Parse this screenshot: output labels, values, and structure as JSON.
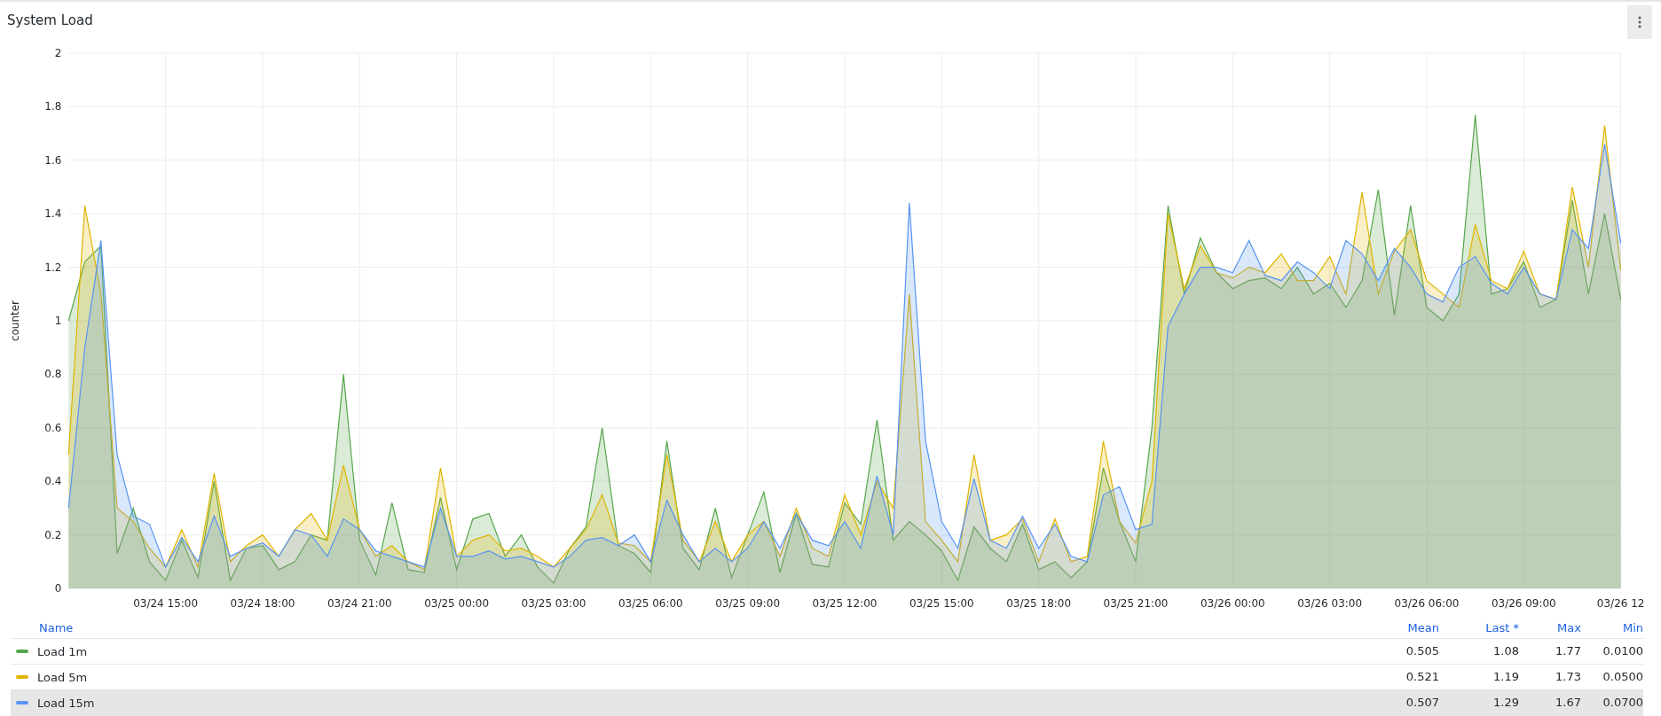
{
  "panel": {
    "title": "System Load",
    "chart_data": {
      "type": "area",
      "ylabel": "counter",
      "categories": [
        null,
        null,
        null,
        null,
        null,
        null,
        "03/24 15:00",
        null,
        null,
        null,
        null,
        null,
        "03/24 18:00",
        null,
        null,
        null,
        null,
        null,
        "03/24 21:00",
        null,
        null,
        null,
        null,
        null,
        "03/25 00:00",
        null,
        null,
        null,
        null,
        null,
        "03/25 03:00",
        null,
        null,
        null,
        null,
        null,
        "03/25 06:00",
        null,
        null,
        null,
        null,
        null,
        "03/25 09:00",
        null,
        null,
        null,
        null,
        null,
        "03/25 12:00",
        null,
        null,
        null,
        null,
        null,
        "03/25 15:00",
        null,
        null,
        null,
        null,
        null,
        "03/25 18:00",
        null,
        null,
        null,
        null,
        null,
        "03/25 21:00",
        null,
        null,
        null,
        null,
        null,
        "03/26 00:00",
        null,
        null,
        null,
        null,
        null,
        "03/26 03:00",
        null,
        null,
        null,
        null,
        null,
        "03/26 06:00",
        null,
        null,
        null,
        null,
        null,
        "03/26 09:00",
        null,
        null,
        null,
        null,
        null,
        "03/26 12"
      ],
      "series": [
        {
          "name": "Load 1m",
          "color": "#56a64b",
          "values": [
            1.0,
            1.22,
            1.28,
            0.13,
            0.3,
            0.1,
            0.03,
            0.18,
            0.04,
            0.4,
            0.03,
            0.15,
            0.16,
            0.07,
            0.1,
            0.2,
            0.18,
            0.8,
            0.18,
            0.05,
            0.32,
            0.07,
            0.06,
            0.34,
            0.07,
            0.26,
            0.28,
            0.12,
            0.2,
            0.08,
            0.02,
            0.15,
            0.23,
            0.6,
            0.16,
            0.13,
            0.06,
            0.55,
            0.15,
            0.07,
            0.3,
            0.04,
            0.2,
            0.36,
            0.06,
            0.28,
            0.09,
            0.08,
            0.32,
            0.24,
            0.63,
            0.18,
            0.25,
            0.2,
            0.14,
            0.03,
            0.23,
            0.15,
            0.1,
            0.24,
            0.07,
            0.1,
            0.04,
            0.1,
            0.45,
            0.25,
            0.1,
            0.6,
            1.43,
            1.1,
            1.31,
            1.18,
            1.12,
            1.15,
            1.16,
            1.12,
            1.2,
            1.1,
            1.14,
            1.05,
            1.15,
            1.49,
            1.02,
            1.43,
            1.05,
            1.0,
            1.1,
            1.77,
            1.1,
            1.12,
            1.22,
            1.05,
            1.08,
            1.45,
            1.1,
            1.4,
            1.08
          ]
        },
        {
          "name": "Load 5m",
          "color": "#e0b400",
          "values": [
            0.5,
            1.43,
            1.1,
            0.3,
            0.25,
            0.15,
            0.08,
            0.22,
            0.08,
            0.43,
            0.1,
            0.16,
            0.2,
            0.12,
            0.22,
            0.28,
            0.18,
            0.46,
            0.22,
            0.12,
            0.16,
            0.1,
            0.07,
            0.45,
            0.12,
            0.18,
            0.2,
            0.14,
            0.15,
            0.12,
            0.08,
            0.15,
            0.22,
            0.35,
            0.17,
            0.16,
            0.1,
            0.5,
            0.18,
            0.1,
            0.25,
            0.1,
            0.2,
            0.25,
            0.12,
            0.3,
            0.15,
            0.12,
            0.35,
            0.2,
            0.4,
            0.3,
            1.1,
            0.25,
            0.18,
            0.1,
            0.5,
            0.18,
            0.2,
            0.26,
            0.1,
            0.26,
            0.1,
            0.12,
            0.55,
            0.25,
            0.17,
            0.4,
            1.4,
            1.12,
            1.28,
            1.18,
            1.16,
            1.2,
            1.18,
            1.25,
            1.15,
            1.15,
            1.24,
            1.1,
            1.48,
            1.1,
            1.26,
            1.34,
            1.15,
            1.1,
            1.05,
            1.36,
            1.15,
            1.12,
            1.26,
            1.1,
            1.08,
            1.5,
            1.2,
            1.73,
            1.19
          ]
        },
        {
          "name": "Load 15m",
          "color": "#5794f2",
          "values": [
            0.3,
            0.9,
            1.3,
            0.5,
            0.27,
            0.24,
            0.08,
            0.19,
            0.1,
            0.27,
            0.12,
            0.15,
            0.17,
            0.12,
            0.22,
            0.2,
            0.12,
            0.26,
            0.22,
            0.14,
            0.12,
            0.1,
            0.08,
            0.3,
            0.12,
            0.12,
            0.14,
            0.11,
            0.12,
            0.1,
            0.08,
            0.12,
            0.18,
            0.19,
            0.16,
            0.2,
            0.1,
            0.33,
            0.2,
            0.1,
            0.15,
            0.1,
            0.15,
            0.25,
            0.15,
            0.28,
            0.18,
            0.16,
            0.25,
            0.15,
            0.42,
            0.2,
            1.44,
            0.55,
            0.25,
            0.15,
            0.41,
            0.18,
            0.15,
            0.27,
            0.15,
            0.24,
            0.12,
            0.1,
            0.35,
            0.38,
            0.22,
            0.24,
            0.98,
            1.1,
            1.2,
            1.2,
            1.18,
            1.3,
            1.17,
            1.15,
            1.22,
            1.18,
            1.12,
            1.3,
            1.25,
            1.15,
            1.27,
            1.2,
            1.1,
            1.07,
            1.2,
            1.24,
            1.14,
            1.1,
            1.2,
            1.1,
            1.08,
            1.34,
            1.27,
            1.66,
            1.29
          ]
        }
      ],
      "ylim": [
        0,
        2
      ],
      "grid": true,
      "yticks": [
        0,
        0.2,
        0.4,
        0.6,
        0.8,
        1,
        1.2,
        1.4,
        1.6,
        1.8,
        2
      ]
    }
  },
  "legend": {
    "columns": [
      "Name",
      "Mean",
      "Last *",
      "Max",
      "Min"
    ],
    "rows": [
      {
        "selected": false,
        "values": [
          "0.505",
          "1.08",
          "1.77",
          "0.0100"
        ]
      },
      {
        "selected": false,
        "values": [
          "0.521",
          "1.19",
          "1.73",
          "0.0500"
        ]
      },
      {
        "selected": true,
        "values": [
          "0.507",
          "1.29",
          "1.67",
          "0.0700"
        ]
      }
    ]
  }
}
